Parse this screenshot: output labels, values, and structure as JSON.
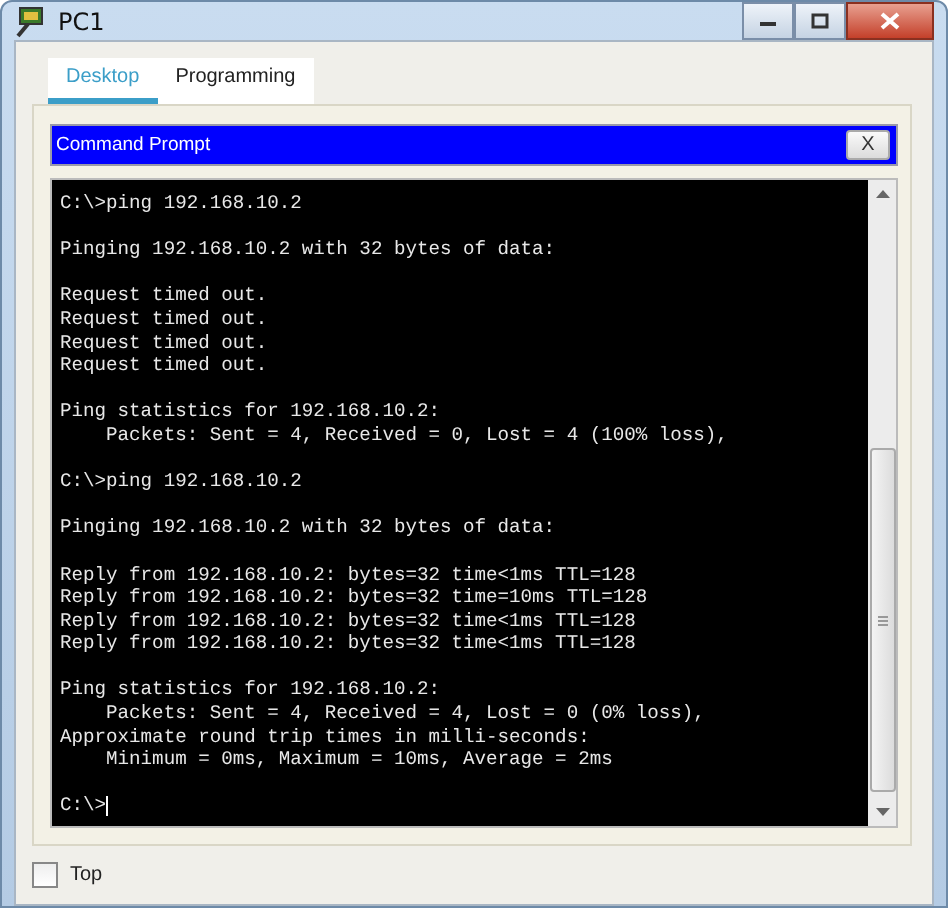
{
  "window": {
    "title": "PC1"
  },
  "tabs": [
    {
      "label": "Desktop",
      "selected": true
    },
    {
      "label": "Programming",
      "selected": false
    }
  ],
  "command_prompt": {
    "title": "Command Prompt",
    "close_label": "X",
    "blocks": [
      [
        "C:\\>ping 192.168.10.2"
      ],
      [
        "Pinging 192.168.10.2 with 32 bytes of data:"
      ],
      [
        "Request timed out.",
        "Request timed out.",
        "Request timed out.",
        "Request timed out."
      ],
      [
        "Ping statistics for 192.168.10.2:",
        "    Packets: Sent = 4, Received = 0, Lost = 4 (100% loss),"
      ],
      [
        "C:\\>ping 192.168.10.2"
      ],
      [
        "Pinging 192.168.10.2 with 32 bytes of data:"
      ],
      [
        "Reply from 192.168.10.2: bytes=32 time<1ms TTL=128",
        "Reply from 192.168.10.2: bytes=32 time=10ms TTL=128",
        "Reply from 192.168.10.2: bytes=32 time<1ms TTL=128",
        "Reply from 192.168.10.2: bytes=32 time<1ms TTL=128"
      ],
      [
        "Ping statistics for 192.168.10.2:",
        "    Packets: Sent = 4, Received = 4, Lost = 0 (0% loss),",
        "Approximate round trip times in milli-seconds:",
        "    Minimum = 0ms, Maximum = 10ms, Average = 2ms"
      ]
    ],
    "prompt": "C:\\>"
  },
  "top_checkbox": {
    "label": "Top",
    "checked": false
  }
}
